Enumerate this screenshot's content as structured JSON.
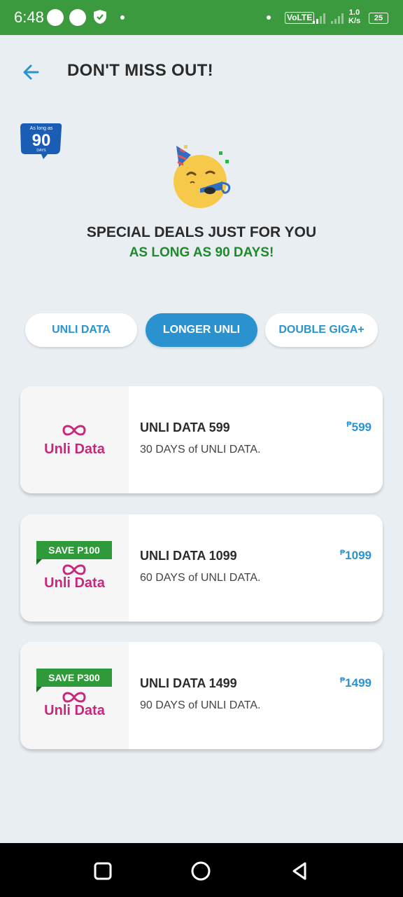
{
  "status_bar": {
    "time": "6:48",
    "network_type": "VoLTE",
    "net_speed_value": "1.0",
    "net_speed_unit": "K/s",
    "battery": "25"
  },
  "header": {
    "title": "DON'T MISS OUT!"
  },
  "badge": {
    "top": "As long as",
    "number": "90",
    "bottom": "DAYS"
  },
  "hero": {
    "headline": "SPECIAL DEALS JUST FOR YOU",
    "subheadline": "AS LONG AS 90 DAYS!"
  },
  "tabs": [
    {
      "label": "UNLI DATA",
      "active": false
    },
    {
      "label": "LONGER UNLI",
      "active": true
    },
    {
      "label": "DOUBLE GIGA+",
      "active": false
    }
  ],
  "offers": [
    {
      "brand": "Unli Data",
      "save_tag": "",
      "name": "UNLI DATA 599",
      "description": "30 DAYS of UNLI DATA.",
      "currency": "₱",
      "price": "599"
    },
    {
      "brand": "Unli Data",
      "save_tag": "SAVE P100",
      "name": "UNLI DATA 1099",
      "description": "60 DAYS of UNLI DATA.",
      "currency": "₱",
      "price": "1099"
    },
    {
      "brand": "Unli Data",
      "save_tag": "SAVE P300",
      "name": "UNLI DATA 1499",
      "description": "90 DAYS of UNLI DATA.",
      "currency": "₱",
      "price": "1499"
    }
  ],
  "colors": {
    "status_bar": "#3c9a3e",
    "accent_blue": "#2a93cf",
    "green_text": "#1f8a2c",
    "brand_magenta": "#c8287c"
  },
  "icons": {
    "back": "arrow-left-icon",
    "nav_recents": "square-icon",
    "nav_home": "circle-icon",
    "nav_back": "triangle-back-icon"
  }
}
